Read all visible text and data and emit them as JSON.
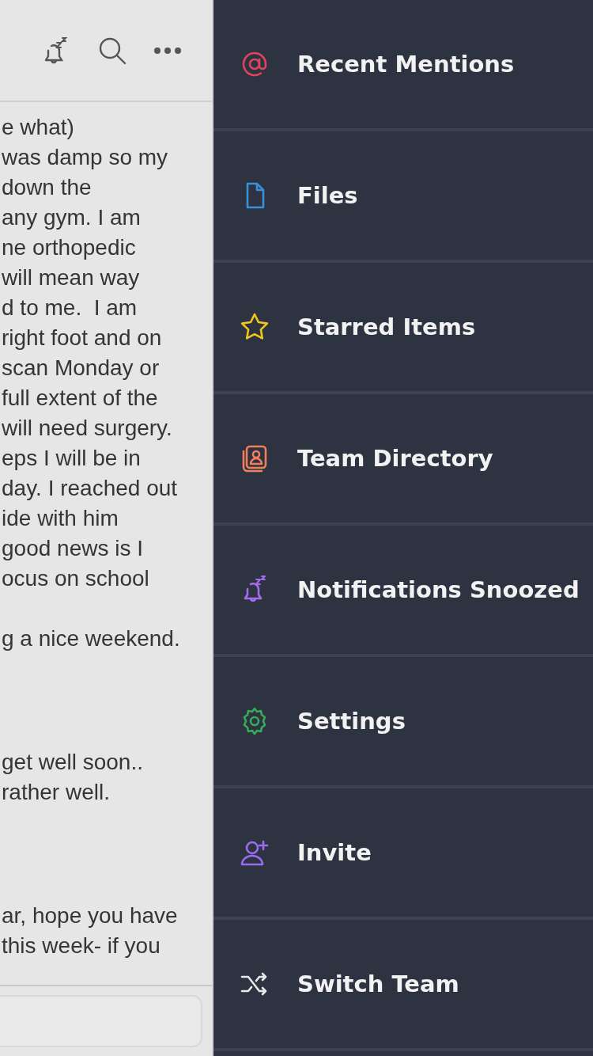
{
  "messages": [
    {
      "paragraphs": [
        [
          "e what)",
          "was damp so my",
          "down the",
          "any gym. I am",
          "ne orthopedic",
          "will mean way",
          "d to me.  I am",
          "right foot and on",
          "scan Monday or",
          "full extent of the",
          "will need surgery.",
          "eps I will be in",
          "day. I reached out",
          "ide with him",
          "good news is I",
          "ocus on school"
        ],
        [
          "g a nice weekend."
        ]
      ]
    },
    {
      "paragraphs": [
        [
          "get well soon..",
          "rather well."
        ]
      ]
    },
    {
      "paragraphs": [
        [
          "ar, hope you have",
          "this week- if you"
        ]
      ]
    }
  ],
  "menu": [
    {
      "kind": "mentions",
      "label": "Recent Mentions",
      "color": "#e0435a"
    },
    {
      "kind": "files",
      "label": "Files",
      "color": "#3a8fd9"
    },
    {
      "kind": "star",
      "label": "Starred Items",
      "color": "#f2c618"
    },
    {
      "kind": "directory",
      "label": "Team Directory",
      "color": "#f07f5e"
    },
    {
      "kind": "snooze",
      "label": "Notifications Snoozed",
      "color": "#a56cf0"
    },
    {
      "kind": "settings",
      "label": "Settings",
      "color": "#3aa95a"
    },
    {
      "kind": "invite",
      "label": "Invite",
      "color": "#9b6cf0"
    },
    {
      "kind": "switch",
      "label": "Switch Team",
      "color": "#e8e8ea"
    }
  ]
}
